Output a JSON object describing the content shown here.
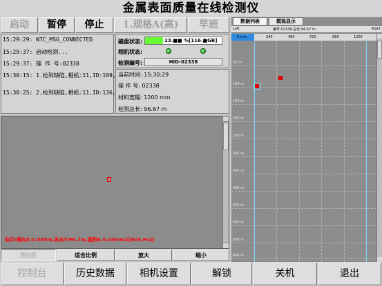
{
  "app": {
    "title": "金属表面质量在线检测仪"
  },
  "toolbar": {
    "start": "启动",
    "pause": "暂停",
    "stop": "停止",
    "spec": "1.规格A(高)",
    "shift": "早班"
  },
  "log": [
    "15:29:29: NTC_MSG_CONNECTED",
    "15:29:37: 启动检测...",
    "15:29:37: 操 作 号:02338",
    "15:30:15: 1.检到缺陷,相机:11,ID:109,",
    "15:30:25: 2,检到缺陷,相机:11,ID:136,"
  ],
  "status": {
    "disk_label": "磁盘状态:",
    "disk_value": "23.■■ %[116.■GB]",
    "disk_fill_percent": 23,
    "camera_label": "相机状态:",
    "serial_label": "检测编号:",
    "serial_value": "HID-02338"
  },
  "info": {
    "time": "当前时间:  15:30:29",
    "operator": "操 作 号:  02338",
    "width": "材料宽幅:  1200 mm",
    "length": "检测总长:  96.67 m"
  },
  "image_view": {
    "status_text": "砧印:横向X:0.085m,纵向Y:96.7m,面积A:0.00mm2[W:0,H:4]",
    "buttons": [
      "原始图",
      "适合比例",
      "放大",
      "缩小"
    ]
  },
  "right_panel": {
    "tabs": [
      "数据列表",
      "模拟显示"
    ],
    "header_left": "Left",
    "header_center": "编号:02338-总长:96.67 m",
    "header_right": "Right",
    "ruler": [
      "0 mm",
      "240",
      "480",
      "720",
      "960",
      "1200"
    ],
    "y_ticks": [
      "50 m",
      "100 m",
      "150 m",
      "200 m",
      "250 m",
      "300 m",
      "350 m",
      "400 m",
      "450 m",
      "500 m",
      "550 m",
      "600 m"
    ]
  },
  "bottom_nav": [
    "控制台",
    "历史数据",
    "相机设置",
    "解锁",
    "关机",
    "退出"
  ],
  "colors": {
    "disk_green": "#66ff33",
    "defect_red": "#e00000",
    "led_green": "#1fa81f",
    "status_text_red": "#ff0000"
  }
}
